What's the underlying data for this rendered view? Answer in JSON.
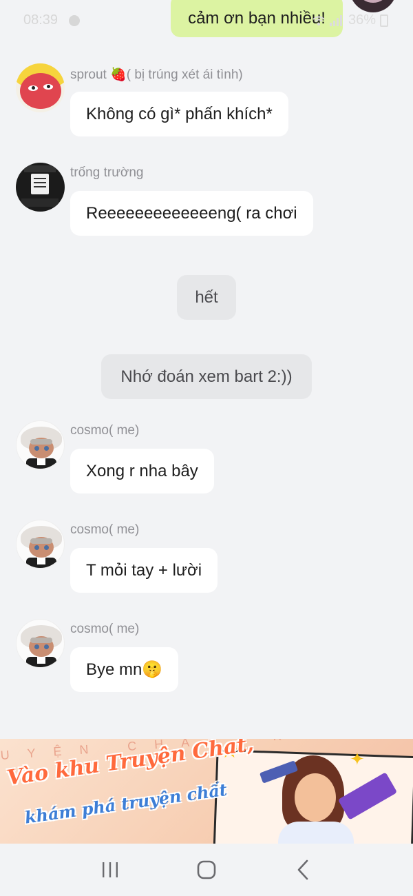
{
  "status_bar": {
    "time": "08:39",
    "battery": "36%"
  },
  "top_message": {
    "text": "cảm ơn bạn nhiều!"
  },
  "messages": [
    {
      "sender": "sprout 🍓( bị trúng xét ái tình)",
      "text": "Không có gì* phấn khích*",
      "avatar": "sprout-avatar"
    },
    {
      "sender": "trống trường",
      "text": "Reeeeeeeeeeeeeng( ra chơi",
      "avatar": "drum-avatar"
    },
    {
      "sender": "cosmo( me)",
      "text": "Xong r nha bây",
      "avatar": "cosmo-avatar"
    },
    {
      "sender": "cosmo( me)",
      "text": "T mỏi tay + lười",
      "avatar": "cosmo-avatar"
    },
    {
      "sender": "cosmo( me)",
      "text": "Bye mn🤫",
      "avatar": "cosmo-avatar"
    }
  ],
  "system_messages": [
    {
      "text": "hết"
    },
    {
      "text": "Nhớ đoán xem bart 2:))"
    }
  ],
  "banner": {
    "marquee": "UYỆN CHAT, KHÁM PHÁ",
    "title": "Vào khu Truyện Chat,",
    "subtitle": "khám phá truyện chất",
    "accent_color": "#ff6a3d",
    "sub_color": "#3d7ed6"
  },
  "nav": {
    "recent_icon": "recent-apps-icon",
    "home_icon": "home-icon",
    "back_icon": "back-icon"
  }
}
